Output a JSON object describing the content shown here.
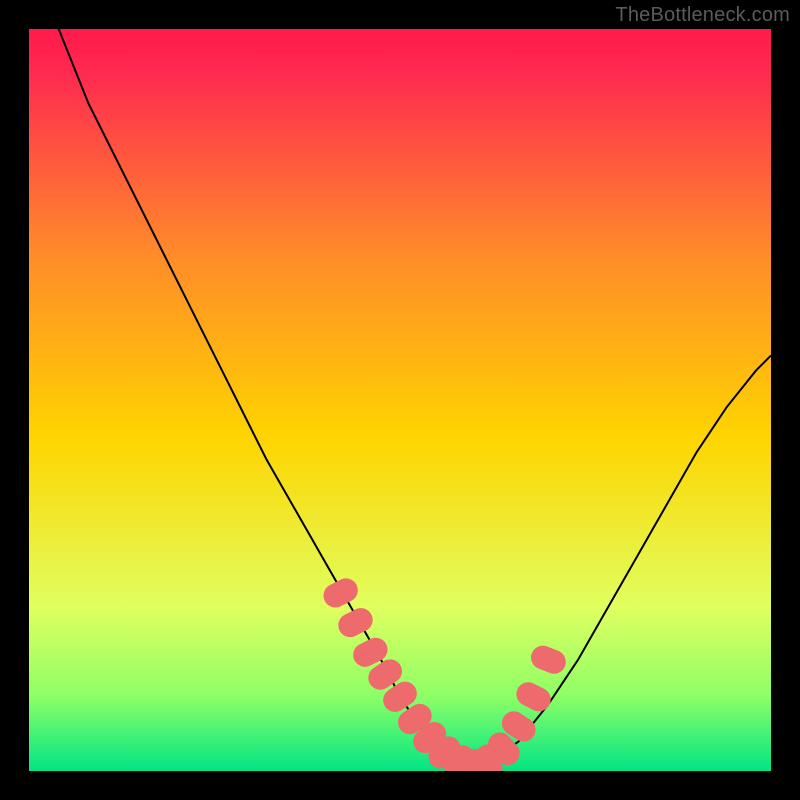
{
  "watermark": "TheBottleneck.com",
  "chart_data": {
    "type": "line",
    "title": "",
    "xlabel": "",
    "ylabel": "",
    "xlim": [
      0,
      100
    ],
    "ylim": [
      0,
      100
    ],
    "grid": false,
    "legend": false,
    "legend_position": "none",
    "background_gradient": {
      "top": "#ff1a4b",
      "mid": "#ffd400",
      "bottom": "#00e584"
    },
    "series": [
      {
        "name": "bottleneck-curve",
        "stroke": "#000000",
        "x": [
          4,
          8,
          12,
          16,
          20,
          24,
          28,
          32,
          36,
          40,
          44,
          48,
          50,
          52,
          54,
          56,
          58,
          60,
          62,
          66,
          70,
          74,
          78,
          82,
          86,
          90,
          94,
          98,
          100
        ],
        "values": [
          100,
          90,
          82,
          74,
          66,
          58,
          50,
          42,
          35,
          28,
          21,
          14,
          10,
          7,
          4,
          2,
          1,
          0.5,
          1,
          4,
          9,
          15,
          22,
          29,
          36,
          43,
          49,
          54,
          56
        ]
      }
    ],
    "highlight_band": {
      "name": "optimal-range",
      "color": "#ed6b6c",
      "x_center": [
        42,
        44,
        46,
        48,
        50,
        52,
        54,
        56,
        58,
        60,
        62,
        64,
        66,
        68,
        70
      ],
      "y_center": [
        24,
        20,
        16,
        13,
        10,
        7,
        4.5,
        2.5,
        1.2,
        0.6,
        1.2,
        3,
        6,
        10,
        15
      ],
      "x_width": 3.2,
      "y_height": 4.8
    },
    "green_band": {
      "name": "bottom-green-band",
      "color_top": "#e9ff7a",
      "color_bottom": "#00e584",
      "y_start": 84,
      "y_end": 100
    }
  }
}
